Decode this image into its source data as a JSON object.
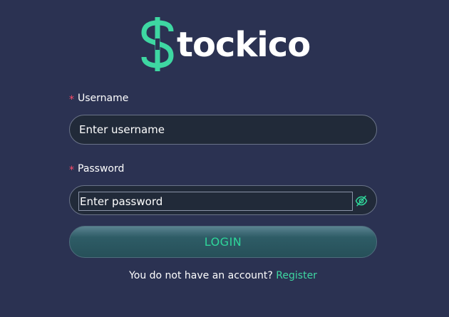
{
  "brand": {
    "name": "tockico",
    "logo_symbol": "$",
    "accent_color": "#3ed7a2"
  },
  "form": {
    "username": {
      "label": "Username",
      "required_mark": "*",
      "placeholder": "Enter username",
      "value": ""
    },
    "password": {
      "label": "Password",
      "required_mark": "*",
      "placeholder": "Enter password",
      "value": "",
      "toggle_icon": "eye-slash-icon"
    },
    "login_button": "LOGIN",
    "register_prompt": "You do not have an account?",
    "register_link": "Register"
  },
  "colors": {
    "background": "#2b3252",
    "required": "#ff4d6a",
    "button_text": "#2fd69a"
  }
}
